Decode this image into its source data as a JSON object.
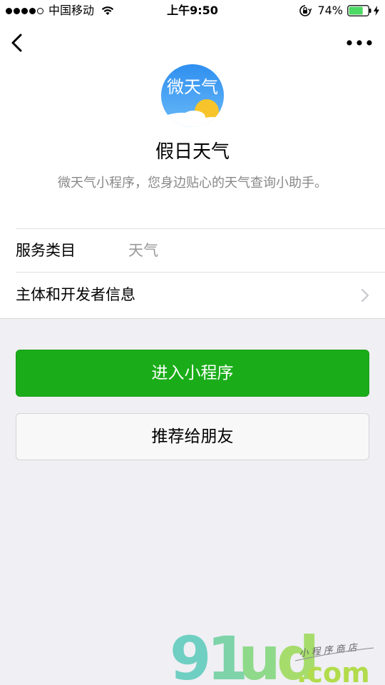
{
  "status_bar": {
    "carrier": "中国移动",
    "time": "上午9:50",
    "battery_percent": "74%",
    "battery_level": 0.74,
    "signal_strength": 4,
    "signal_total": 5
  },
  "nav": {
    "back_icon": "chevron-left-icon",
    "more_icon": "ellipsis-icon"
  },
  "app": {
    "avatar_text": "微天气",
    "name": "假日天气",
    "description": "微天气小程序，您身边贴心的天气查询小助手。"
  },
  "info": {
    "category_label": "服务类目",
    "category_value": "天气",
    "developer_label": "主体和开发者信息"
  },
  "buttons": {
    "enter_label": "进入小程序",
    "share_label": "推荐给朋友"
  },
  "watermark": {
    "text": "91ud.com 小程序商店"
  },
  "colors": {
    "accent_green": "#1aad19",
    "background": "#efeff4",
    "battery_green": "#4cd964",
    "secondary_text": "#888888"
  }
}
